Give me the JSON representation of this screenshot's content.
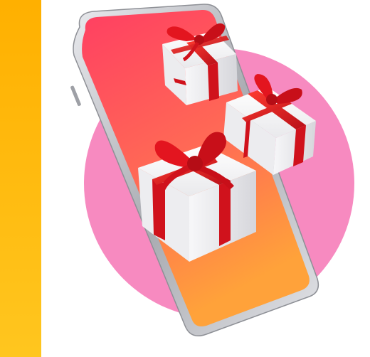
{
  "colors": {
    "side_bar_top": "#FFB300",
    "side_bar_bottom": "#FFC21A",
    "circle": "#F78BC0",
    "screen_top": "#FF4466",
    "screen_bottom": "#FF9A3C",
    "phone_frame": "#C8CACF",
    "gift_box": "#F4F4F6",
    "ribbon": "#E0141E"
  },
  "icons": {
    "phone": "smartphone-illustration",
    "gift": "gift-box-icon"
  }
}
